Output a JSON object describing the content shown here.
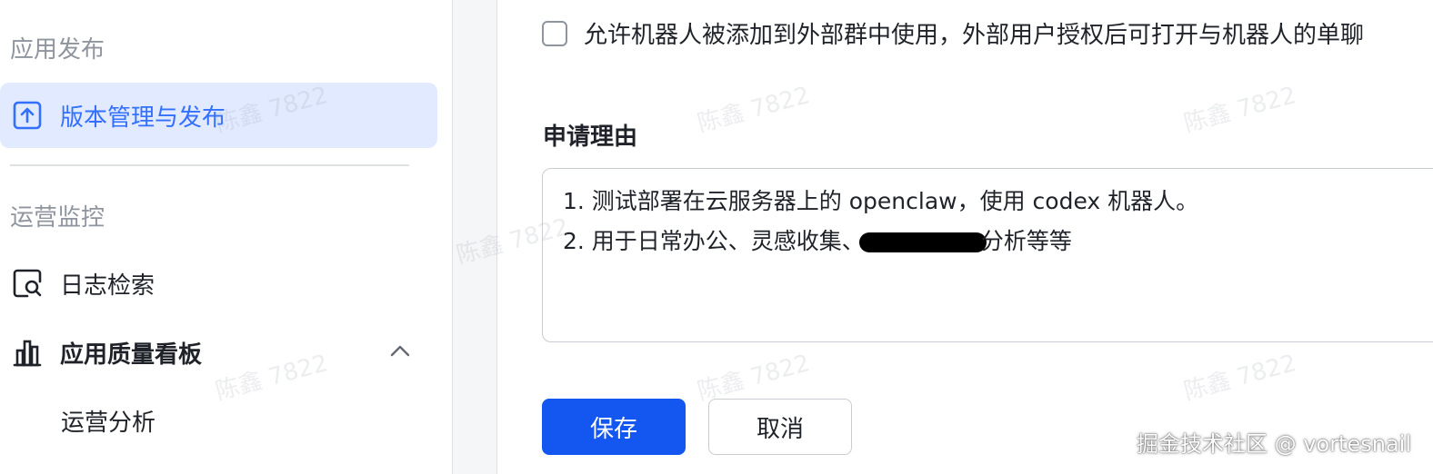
{
  "sidebar": {
    "section_release": "应用发布",
    "item_version": "版本管理与发布",
    "section_ops": "运营监控",
    "item_logs": "日志检索",
    "item_quality": "应用质量看板",
    "sub_ops_analysis": "运营分析"
  },
  "form": {
    "checkbox_label": "允许机器人被添加到外部群中使用，外部用户授权后可打开与机器人的单聊",
    "checkbox_checked": false,
    "reason_label": "申请理由",
    "reason_line1": "1. 测试部署在云服务器上的 openclaw，使用 codex 机器人。",
    "reason_line2_pre": "2. 用于日常办公、灵感收集、",
    "reason_line2_post": "分析等等",
    "save_label": "保存",
    "cancel_label": "取消"
  },
  "watermark": {
    "text": "陈鑫 7822",
    "site": "掘金技术社区 @ vortesnail"
  },
  "colors": {
    "accent": "#3370ff",
    "primary_button": "#1456f0",
    "active_bg": "#e1eaff"
  }
}
